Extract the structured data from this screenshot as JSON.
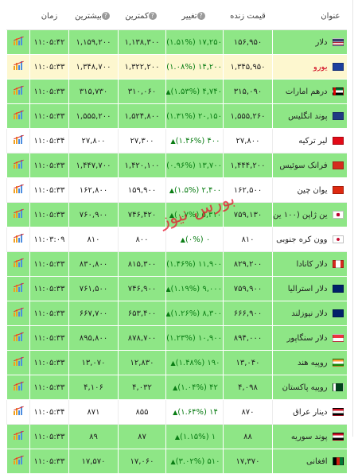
{
  "headers": {
    "name": "عنوان",
    "live": "قیمت زنده",
    "change": "تغییر",
    "low": "کمترین",
    "high": "بیشترین",
    "time": "زمان",
    "help_glyph": "?"
  },
  "watermark": "بورس نیوز",
  "rows": [
    {
      "name": "دلار",
      "flag": "us",
      "live": "۱۵۶,۹۵۰",
      "change": "۱۷,۲۵۰ (۱.۵۱%)",
      "low": "۱,۱۳۸,۳۰۰",
      "high": "۱,۱۵۹,۲۰۰",
      "time": "۱۱:۰۵:۴۲",
      "style": "green"
    },
    {
      "name": "یورو",
      "flag": "eu",
      "live": "۱,۳۴۵,۹۵۰",
      "change": "۱۴,۲۰۰ (۱.۰۸%)",
      "low": "۱,۳۲۲,۲۰۰",
      "high": "۱,۳۴۸,۷۰۰",
      "time": "۱۱:۰۵:۳۳",
      "style": "yellow"
    },
    {
      "name": "درهم امارات",
      "flag": "ae",
      "live": "۳۱۵,۰۹۰",
      "change": "۴,۷۴۰ (۱.۵۳%)",
      "low": "۳۱۰,۰۶۰",
      "high": "۳۱۵,۷۳۰",
      "time": "۱۱:۰۵:۳۳",
      "style": "green"
    },
    {
      "name": "پوند انگلیس",
      "flag": "gb",
      "live": "۱,۵۵۵,۲۶۰",
      "change": "۲۰,۱۵۰ (۱.۳۱%)",
      "low": "۱,۵۲۴,۸۰۰",
      "high": "۱,۵۵۵,۲۰۰",
      "time": "۱۱:۰۵:۳۳",
      "style": "green"
    },
    {
      "name": "لیر ترکیه",
      "flag": "tr",
      "live": "۲۷,۸۰۰",
      "change": "۴۰۰ (۱.۴۶%)",
      "low": "۲۷,۳۰۰",
      "high": "۲۷,۸۰۰",
      "time": "۱۱:۰۵:۳۴",
      "style": "white"
    },
    {
      "name": "فرانک سوئیس",
      "flag": "ch",
      "live": "۱,۴۴۴,۲۰۰",
      "change": "۱۳,۷۰۰ (۰.۹۶%)",
      "low": "۱,۴۲۰,۱۰۰",
      "high": "۱,۴۴۷,۷۰۰",
      "time": "۱۱:۰۵:۳۳",
      "style": "green"
    },
    {
      "name": "یوان چین",
      "flag": "cn",
      "live": "۱۶۲,۵۰۰",
      "change": "۲,۴۰۰ (۱.۵%)",
      "low": "۱۵۹,۹۰۰",
      "high": "۱۶۲,۸۰۰",
      "time": "۱۱:۰۵:۳۳",
      "style": "white"
    },
    {
      "name": "ین ژاپن (۱۰۰ ین)",
      "flag": "jp",
      "live": "۷۵۹,۱۳۰",
      "change": "۵,۳۱۰ (۰.۷%)",
      "low": "۷۴۶,۴۲۰",
      "high": "۷۶۰,۹۰۰",
      "time": "۱۱:۰۵:۳۳",
      "style": "green"
    },
    {
      "name": "وون کره جنوبی",
      "flag": "kr",
      "live": "۸۱۰",
      "change": "۰ (۰%)",
      "low": "۸۰۰",
      "high": "۸۱۰",
      "time": "۱۱:۰۳:۰۹",
      "style": "white"
    },
    {
      "name": "دلار کانادا",
      "flag": "ca",
      "live": "۸۲۹,۲۰۰",
      "change": "۱۱,۹۰۰ (۱.۴۶%)",
      "low": "۸۱۵,۳۰۰",
      "high": "۸۳۰,۸۰۰",
      "time": "۱۱:۰۵:۳۳",
      "style": "green"
    },
    {
      "name": "دلار استرالیا",
      "flag": "au",
      "live": "۷۵۹,۹۰۰",
      "change": "۹,۰۰۰ (۱.۱۹%)",
      "low": "۷۴۶,۹۰۰",
      "high": "۷۶۱,۵۰۰",
      "time": "۱۱:۰۵:۳۳",
      "style": "green"
    },
    {
      "name": "دلار نیوزلند",
      "flag": "nz",
      "live": "۶۶۶,۹۰۰",
      "change": "۸,۳۰۰ (۱.۲۶%)",
      "low": "۶۵۳,۴۰۰",
      "high": "۶۶۷,۷۰۰",
      "time": "۱۱:۰۵:۳۳",
      "style": "green"
    },
    {
      "name": "دلار سنگاپور",
      "flag": "sg",
      "live": "۸۹۴,۰۰۰",
      "change": "۱۰,۹۰۰ (۱.۲۳%)",
      "low": "۸۷۸,۷۰۰",
      "high": "۸۹۵,۸۰۰",
      "time": "۱۱:۰۵:۳۳",
      "style": "green"
    },
    {
      "name": "روپیه هند",
      "flag": "in",
      "live": "۱۳,۰۴۰",
      "change": "۱۹۰ (۱.۴۸%)",
      "low": "۱۲,۸۳۰",
      "high": "۱۳,۰۷۰",
      "time": "۱۱:۰۵:۳۳",
      "style": "green"
    },
    {
      "name": "روپیه پاکستان",
      "flag": "pk",
      "live": "۴,۰۹۸",
      "change": "۴۲ (۱.۰۴%)",
      "low": "۴,۰۳۲",
      "high": "۴,۱۰۶",
      "time": "۱۱:۰۵:۳۳",
      "style": "green"
    },
    {
      "name": "دینار عراق",
      "flag": "iq",
      "live": "۸۷۰",
      "change": "۱۴ (۱.۶۴%)",
      "low": "۸۵۵",
      "high": "۸۷۱",
      "time": "۱۱:۰۵:۳۴",
      "style": "white"
    },
    {
      "name": "پوند سوریه",
      "flag": "sy",
      "live": "۸۸",
      "change": "۱ (۱.۱۵%)",
      "low": "۸۷",
      "high": "۸۹",
      "time": "۱۱:۰۵:۳۳",
      "style": "green"
    },
    {
      "name": "افغانی",
      "flag": "af",
      "live": "۱۷,۳۷۰",
      "change": "۵۱۰ (۳.۰۲%)",
      "low": "۱۷,۰۶۰",
      "high": "۱۷,۵۷۰",
      "time": "۱۱:۰۵:۳۳",
      "style": "green"
    }
  ],
  "colors": {
    "green_row": "#8ee686",
    "highlight_row": "#fdf7cf",
    "change_text": "#0a7d14",
    "watermark": "#e8142c"
  },
  "icons": {
    "up_arrow": "▲",
    "chart": "chart-icon",
    "help": "help-icon"
  }
}
